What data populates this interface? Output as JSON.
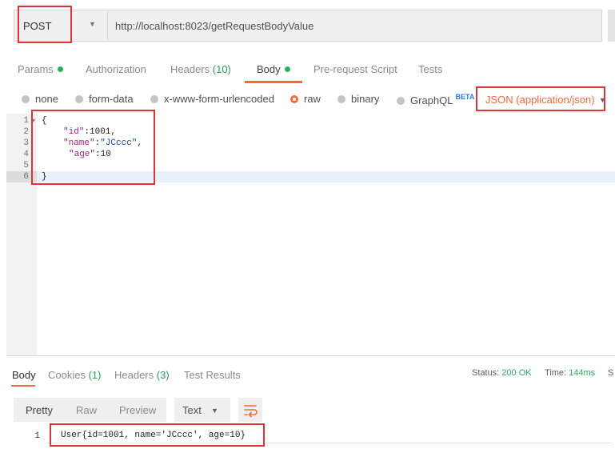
{
  "request": {
    "method": "POST",
    "url": "http://localhost:8023/getRequestBodyValue"
  },
  "tabs": [
    {
      "label": "Params",
      "count": "",
      "dot": true
    },
    {
      "label": "Authorization",
      "count": ""
    },
    {
      "label": "Headers",
      "count": "(10)"
    },
    {
      "label": "Body",
      "count": "",
      "dot": true,
      "active": true
    },
    {
      "label": "Pre-request Script",
      "count": ""
    },
    {
      "label": "Tests",
      "count": ""
    }
  ],
  "body_types": {
    "options": [
      "none",
      "form-data",
      "x-www-form-urlencoded",
      "raw",
      "binary",
      "GraphQL"
    ],
    "selected": "raw",
    "beta_badge": "BETA",
    "content_type": "JSON (application/json)"
  },
  "editor": {
    "line_numbers": [
      "1",
      "2",
      "3",
      "4",
      "5",
      "6"
    ],
    "lines": {
      "l1": "{",
      "l2_key": "\"id\"",
      "l2_rest": ":1001,",
      "l3_key": "\"name\"",
      "l3_colon": ":",
      "l3_val": "\"JCccc\"",
      "l3_comma": ",",
      "l4_key": "\"age\"",
      "l4_rest": ":10",
      "l5": "",
      "l6": "}"
    }
  },
  "response": {
    "tabs": [
      {
        "label": "Body",
        "count": "",
        "active": true
      },
      {
        "label": "Cookies",
        "count": "(1)"
      },
      {
        "label": "Headers",
        "count": "(3)"
      },
      {
        "label": "Test Results",
        "count": ""
      }
    ],
    "status_label": "Status:",
    "status_value": "200 OK",
    "time_label": "Time:",
    "time_value": "144ms",
    "size_label": "S",
    "view_buttons": [
      "Pretty",
      "Raw",
      "Preview"
    ],
    "format": "Text",
    "line_number": "1",
    "output": "User{id=1001, name='JCccc', age=10}"
  },
  "colors": {
    "accent": "#f26b3a",
    "success": "#2eac62",
    "annotation": "#e0323a"
  }
}
